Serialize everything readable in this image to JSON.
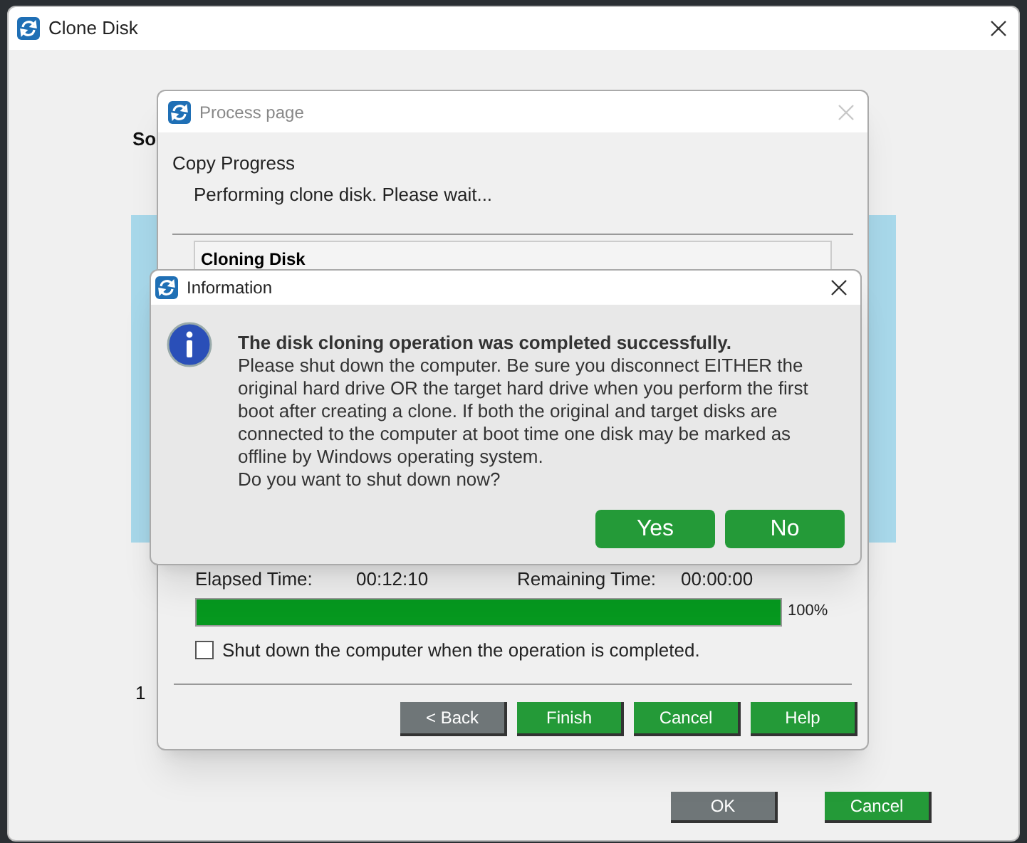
{
  "window": {
    "title": "Clone Disk",
    "background_texts": [
      "So",
      "1"
    ],
    "buttons": [
      {
        "label": "OK",
        "disabled": true
      },
      {
        "label": "Cancel",
        "disabled": false
      }
    ]
  },
  "process_page": {
    "title": "Process page",
    "active": false,
    "heading": "Copy Progress",
    "status": "Performing clone disk. Please wait...",
    "group_title": "Cloning Disk",
    "elapsed_label": "Elapsed Time:",
    "elapsed": "00:12:10",
    "remaining_label": "Remaining Time:",
    "remaining": "00:00:00",
    "progress": {
      "level": 1,
      "reading": "100%"
    },
    "shutdown_option": {
      "label": "Shut down the computer when the operation is completed.",
      "checked": false
    },
    "buttons": [
      {
        "label": "< Back",
        "disabled": true
      },
      {
        "label": "Finish",
        "disabled": false
      },
      {
        "label": "Cancel",
        "disabled": false
      },
      {
        "label": "Help",
        "disabled": false
      }
    ]
  },
  "information_dialog": {
    "title": "Information",
    "headline": "The disk cloning operation was completed successfully.",
    "message": "Please shut down the computer. Be sure you disconnect EITHER the original hard drive OR the target hard drive when you perform the first boot after creating a clone. If both the original and target disks are connected to the computer at boot time one disk may be marked as offline by Windows operating system.",
    "question": "Do you want to shut down now?",
    "buttons": [
      {
        "label": "Yes"
      },
      {
        "label": "No"
      }
    ]
  }
}
